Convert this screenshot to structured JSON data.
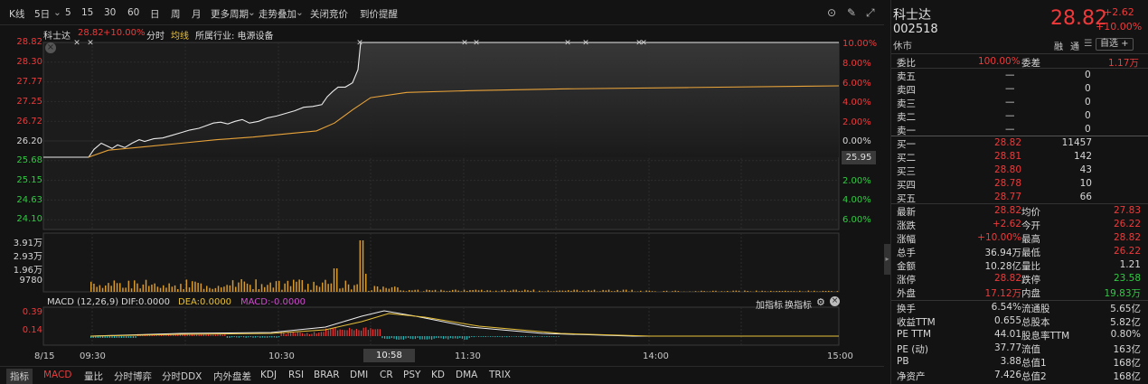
{
  "toolbar": {
    "kline": "K线",
    "five_day": "5日",
    "periods": [
      "5",
      "15",
      "30",
      "60",
      "日",
      "周",
      "月"
    ],
    "more_periods": "更多周期",
    "overlay": "走势叠加",
    "close_auction": "关闭竞价",
    "price_alert": "到价提醒"
  },
  "chart_info": {
    "name": "科士达",
    "price": "28.82",
    "change_pct": "+10.00%",
    "tab_intraday": "分时",
    "tab_avg": "均线",
    "industry": "所属行业: 电源设备"
  },
  "y_price_labels": [
    "28.82",
    "28.30",
    "27.77",
    "27.25",
    "26.72",
    "26.20",
    "25.68",
    "25.15",
    "24.63",
    "24.10"
  ],
  "y_pct_labels": [
    "10.00%",
    "8.00%",
    "6.00%",
    "4.00%",
    "2.00%",
    "0.00%",
    "2.00%",
    "4.00%",
    "6.00%",
    "8.00%"
  ],
  "y_volume_labels": [
    "3.91万",
    "2.93万",
    "1.96万",
    "9780"
  ],
  "current_marker": "25.95",
  "macd": {
    "title": "MACD (12,26,9)",
    "dif": "DIF:0.0000",
    "dea": "DEA:0.0000",
    "macd": "MACD:-0.0000",
    "y_labels": [
      "0.39",
      "0.14"
    ],
    "add_indicator": "加指标",
    "switch_indicator": "换指标"
  },
  "x_labels": {
    "date": "8/15",
    "t0930": "09:30",
    "t1030": "10:30",
    "cursor": "10:58",
    "t1130": "11:30",
    "t1400": "14:00",
    "t1500": "15:00"
  },
  "bottom_tabs": [
    "指标",
    "MACD",
    "量比",
    "分时博弈",
    "分时DDX",
    "内外盘差",
    "KDJ",
    "RSI",
    "BRAR",
    "DMI",
    "CR",
    "PSY",
    "KD",
    "DMA",
    "TRIX"
  ],
  "panel": {
    "name": "科士达",
    "code": "002518",
    "status": "休市",
    "price": "28.82",
    "change": "+2.62",
    "change_pct": "+10.00%",
    "rong": "融",
    "tong": "通",
    "watch": "自选 +",
    "weibi_label": "委比",
    "weibi_value": "100.00%",
    "weicha_label": "委差",
    "weicha_value": "1.17万",
    "asks": [
      {
        "label": "卖五",
        "price": "—",
        "vol": "0"
      },
      {
        "label": "卖四",
        "price": "—",
        "vol": "0"
      },
      {
        "label": "卖三",
        "price": "—",
        "vol": "0"
      },
      {
        "label": "卖二",
        "price": "—",
        "vol": "0"
      },
      {
        "label": "卖一",
        "price": "—",
        "vol": "0"
      }
    ],
    "bids": [
      {
        "label": "买一",
        "price": "28.82",
        "vol": "11457"
      },
      {
        "label": "买二",
        "price": "28.81",
        "vol": "142"
      },
      {
        "label": "买三",
        "price": "28.80",
        "vol": "43"
      },
      {
        "label": "买四",
        "price": "28.78",
        "vol": "10"
      },
      {
        "label": "买五",
        "price": "28.77",
        "vol": "66"
      }
    ],
    "stats": [
      {
        "l1": "最新",
        "v1": "28.82",
        "c1": "red",
        "l2": "均价",
        "v2": "27.83",
        "c2": "red"
      },
      {
        "l1": "涨跌",
        "v1": "+2.62",
        "c1": "red",
        "l2": "今开",
        "v2": "26.22",
        "c2": "red"
      },
      {
        "l1": "涨幅",
        "v1": "+10.00%",
        "c1": "red",
        "l2": "最高",
        "v2": "28.82",
        "c2": "red"
      },
      {
        "l1": "总手",
        "v1": "36.94万",
        "c1": "white",
        "l2": "最低",
        "v2": "26.22",
        "c2": "red"
      },
      {
        "l1": "金额",
        "v1": "10.28亿",
        "c1": "white",
        "l2": "量比",
        "v2": "1.21",
        "c2": "white"
      },
      {
        "l1": "涨停",
        "v1": "28.82",
        "c1": "red",
        "l2": "跌停",
        "v2": "23.58",
        "c2": "green"
      },
      {
        "l1": "外盘",
        "v1": "17.12万",
        "c1": "red",
        "l2": "内盘",
        "v2": "19.83万",
        "c2": "green"
      }
    ],
    "fundamentals": [
      {
        "l1": "换手",
        "v1": "6.54%",
        "l2": "流通股",
        "v2": "5.65亿"
      },
      {
        "l1": "收益TTM",
        "v1": "0.655",
        "l2": "总股本",
        "v2": "5.82亿"
      },
      {
        "l1": "PE TTM",
        "v1": "44.01",
        "l2": "股息率TTM",
        "v2": "0.80%"
      },
      {
        "l1": "PE (动)",
        "v1": "37.77",
        "l2": "流值",
        "v2": "163亿"
      },
      {
        "l1": "PB",
        "v1": "3.88",
        "l2": "总值1",
        "v2": "168亿"
      },
      {
        "l1": "净资产",
        "v1": "7.426",
        "l2": "总值2",
        "v2": "168亿"
      }
    ]
  },
  "colors": {
    "up": "#f0393a",
    "down": "#2ecc40",
    "price_line": "#e8e8e8",
    "avg_line": "#e8a33a",
    "background": "#131313"
  }
}
